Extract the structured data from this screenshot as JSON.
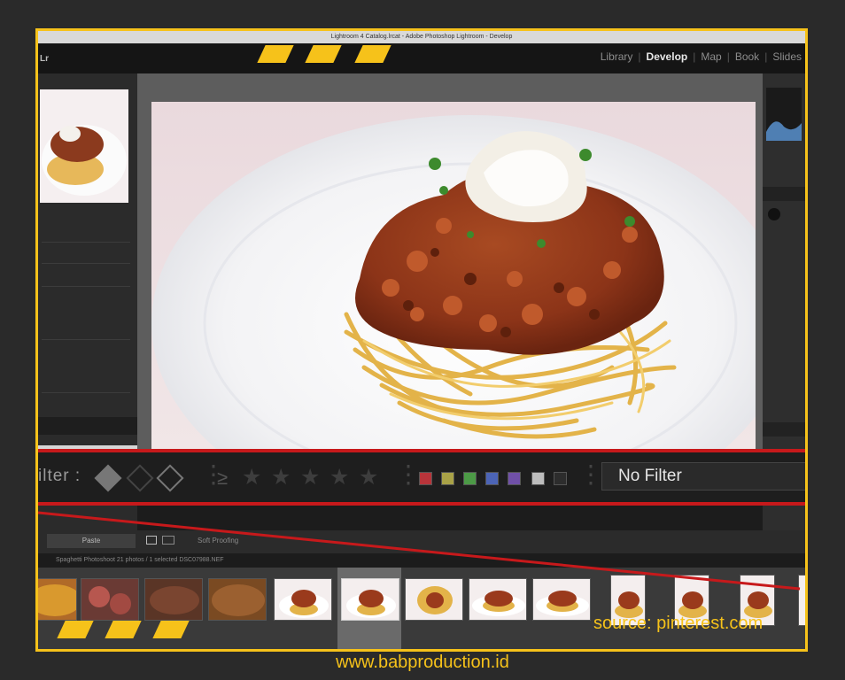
{
  "window": {
    "title": "Lightroom 4 Catalog.lrcat - Adobe Photoshop Lightroom - Develop"
  },
  "modules": {
    "items": [
      {
        "label": "Library",
        "active": false
      },
      {
        "label": "Develop",
        "active": true
      },
      {
        "label": "Map",
        "active": false
      },
      {
        "label": "Book",
        "active": false
      },
      {
        "label": "Slides",
        "active": false
      }
    ],
    "separator": "|"
  },
  "filterbar": {
    "label": "ilter :",
    "rating_operator": "≥",
    "stars": [
      "★",
      "★",
      "★",
      "★",
      "★"
    ],
    "color_labels": [
      "#b8343a",
      "#a9a247",
      "#4c9a46",
      "#4c64b6",
      "#7050a8",
      "#bdbdbd",
      "#2d2d2d"
    ],
    "preset_value": "No Filter"
  },
  "toolbar": {
    "paste_label": "Paste",
    "soft_proofing_label": "Soft Proofing"
  },
  "filmstrip": {
    "info_text": "Spaghetti Photoshoot    21 photos / 1 selected  DSC07988.NEF"
  },
  "credits": {
    "source": "source: pinterest.com",
    "website": "www.babproduction.id"
  },
  "colors": {
    "accent": "#f6c21a",
    "highlight_red": "#c7191b"
  }
}
